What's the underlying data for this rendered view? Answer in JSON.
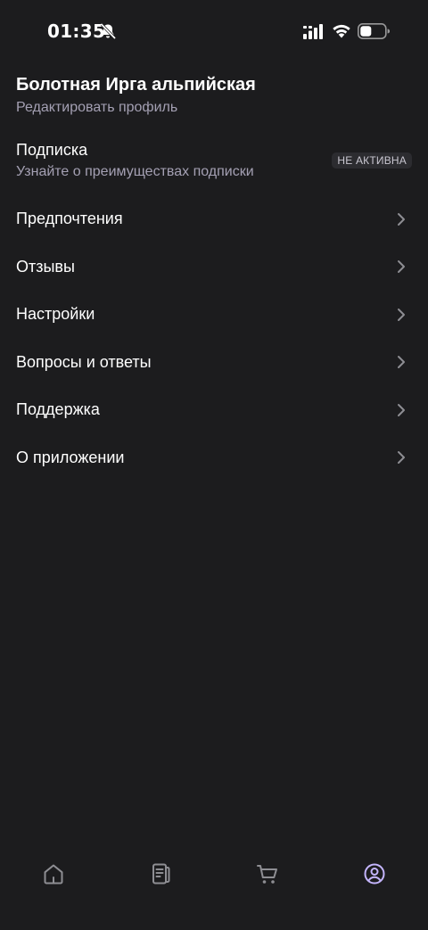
{
  "status_bar": {
    "time": "01:35",
    "icons": [
      "bell-slash-icon",
      "signal-icon",
      "wifi-icon",
      "battery-icon"
    ]
  },
  "profile": {
    "name": "Болотная Ирга альпийская",
    "edit_label": "Редактировать профиль"
  },
  "subscription": {
    "title": "Подписка",
    "subtitle": "Узнайте о преимуществах подписки",
    "status": "НЕ АКТИВНА"
  },
  "menu": {
    "items": [
      {
        "label": "Предпочтения"
      },
      {
        "label": "Отзывы"
      },
      {
        "label": "Настройки"
      },
      {
        "label": "Вопросы и ответы"
      },
      {
        "label": "Поддержка"
      },
      {
        "label": "О приложении"
      }
    ]
  },
  "bottom_nav": {
    "tabs": [
      {
        "icon": "home-icon",
        "active": false
      },
      {
        "icon": "catalog-icon",
        "active": false
      },
      {
        "icon": "cart-icon",
        "active": false
      },
      {
        "icon": "profile-icon",
        "active": true
      }
    ]
  },
  "colors": {
    "background": "#1c1c1e",
    "text_primary": "#ffffff",
    "text_secondary": "#a4a0b3",
    "badge_bg": "#2c2c30",
    "chevron": "#8e8e93",
    "nav_inactive": "#8e8e93",
    "nav_active": "#c4b5fd"
  }
}
